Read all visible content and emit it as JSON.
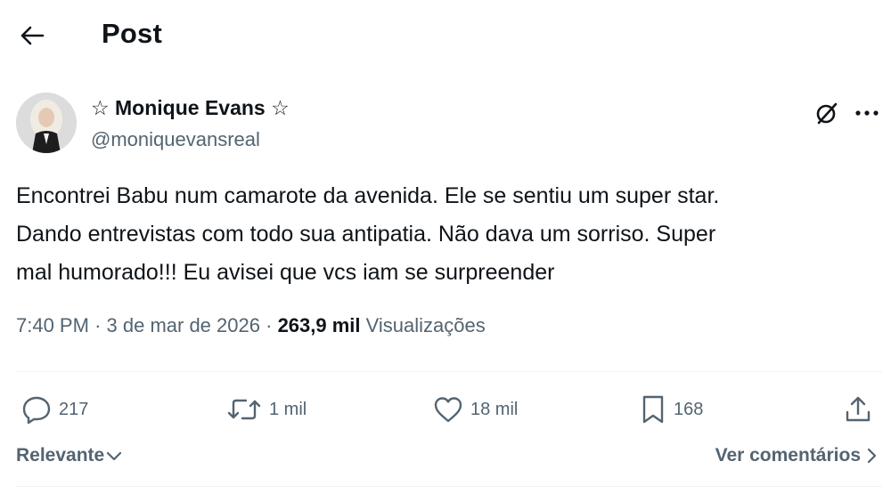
{
  "header": {
    "title": "Post",
    "back_icon": "arrow-left-icon"
  },
  "author": {
    "display_name": "☆ Monique Evans ☆",
    "handle": "@moniquevansreal",
    "avatar_icon": "avatar-photo"
  },
  "post": {
    "text": "Encontrei Babu num camarote da avenida. Ele se sentiu um super star.\nDando entrevistas com todo sua antipatia. Não dava um sorriso. Super\nmal humorado!!! Eu avisei que vcs iam se surpreender",
    "time": "7:40 PM",
    "date": "3 de mar de 2026",
    "separator": "·",
    "views_count": "263,9 mil",
    "views_label": "Visualizações"
  },
  "actions": {
    "replies": "217",
    "reposts": "1 mil",
    "likes": "18 mil",
    "bookmarks": "168"
  },
  "footer": {
    "sort_label": "Relevante",
    "see_comments_label": "Ver comentários"
  },
  "colors": {
    "text_primary": "#0f1419",
    "text_secondary": "#536471",
    "divider": "#eff3f4"
  }
}
